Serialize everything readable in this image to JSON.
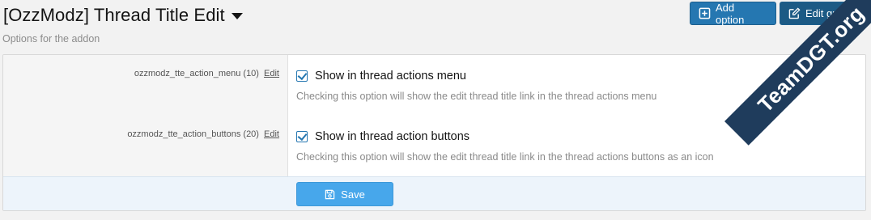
{
  "header": {
    "title": "[OzzModz] Thread Title Edit",
    "subtitle": "Options for the addon",
    "add_option_label": "Add option",
    "edit_group_label": "Edit group"
  },
  "options": [
    {
      "name": "ozzmodz_tte_action_menu (10)",
      "edit_link": "Edit",
      "checkbox_label": "Show in thread actions menu",
      "checked": true,
      "description": "Checking this option will show the edit thread title link in the thread actions menu"
    },
    {
      "name": "ozzmodz_tte_action_buttons (20)",
      "edit_link": "Edit",
      "checkbox_label": "Show in thread action buttons",
      "checked": true,
      "description": "Checking this option will show the edit thread title link in the thread actions buttons as an icon"
    }
  ],
  "footer": {
    "save_label": "Save"
  },
  "watermark": "TeamDGT.org",
  "colors": {
    "primary_button": "#2577b1",
    "save_button": "#47a7eb",
    "watermark_bg": "#1f3c5c"
  }
}
